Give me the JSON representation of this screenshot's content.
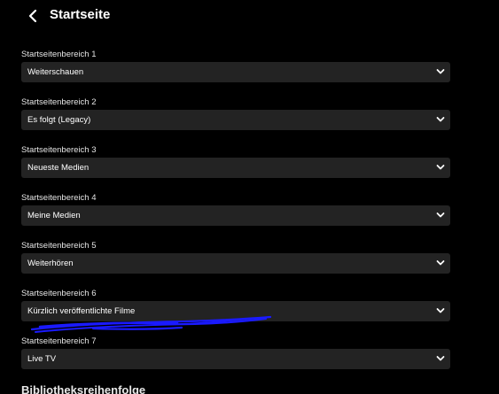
{
  "header": {
    "title": "Startseite",
    "back_icon": "chevron-left-icon"
  },
  "sections": [
    {
      "label": "Startseitenbereich 1",
      "value": "Weiterschauen"
    },
    {
      "label": "Startseitenbereich 2",
      "value": "Es folgt (Legacy)"
    },
    {
      "label": "Startseitenbereich 3",
      "value": "Neueste Medien"
    },
    {
      "label": "Startseitenbereich 4",
      "value": "Meine Medien"
    },
    {
      "label": "Startseitenbereich 5",
      "value": "Weiterhören"
    },
    {
      "label": "Startseitenbereich 6",
      "value": "Kürzlich veröffentlichte Filme"
    },
    {
      "label": "Startseitenbereich 7",
      "value": "Live TV"
    }
  ],
  "next_section": {
    "heading": "Bibliotheksreihenfolge"
  },
  "dropdown_icon": "chevron-down-icon",
  "colors": {
    "background": "#000000",
    "select_background": "#232323",
    "text": "#ffffff",
    "annotation_stroke": "#1a1aff"
  }
}
